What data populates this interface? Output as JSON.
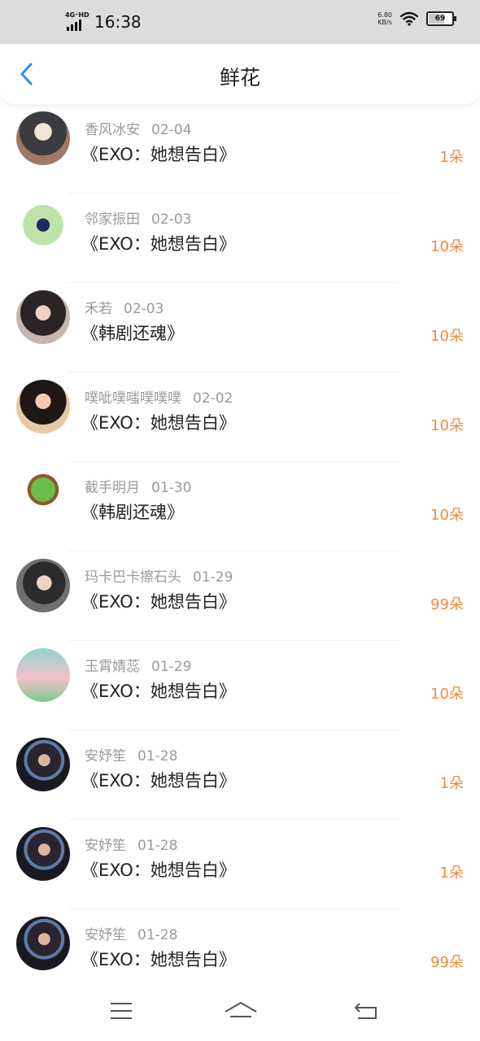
{
  "status_bar": {
    "network": "4G⁺HD",
    "time": "16:38",
    "speed_value": "6.80",
    "speed_unit": "KB/s",
    "battery": "69"
  },
  "header": {
    "title": "鲜花",
    "back_icon": "chevron-left-icon"
  },
  "colors": {
    "accent_blue": "#2a8ef0",
    "count_orange": "#f08a3c",
    "meta_gray": "#9a9a9a"
  },
  "items": [
    {
      "name": "香风冰安",
      "date": "02-04",
      "book": "《EXO：她想告白》",
      "count": "1朵"
    },
    {
      "name": "邻家振田",
      "date": "02-03",
      "book": "《EXO：她想告白》",
      "count": "10朵"
    },
    {
      "name": "禾若",
      "date": "02-03",
      "book": "《韩剧还魂》",
      "count": "10朵"
    },
    {
      "name": "噗呲噗嗤噗噗噗",
      "date": "02-02",
      "book": "《EXO：她想告白》",
      "count": "10朵"
    },
    {
      "name": "截手明月",
      "date": "01-30",
      "book": "《韩剧还魂》",
      "count": "10朵"
    },
    {
      "name": "玛卡巴卡擦石头",
      "date": "01-29",
      "book": "《EXO：她想告白》",
      "count": "99朵"
    },
    {
      "name": "玉霄婧蕊",
      "date": "01-29",
      "book": "《EXO：她想告白》",
      "count": "10朵"
    },
    {
      "name": "安妤笙",
      "date": "01-28",
      "book": "《EXO：她想告白》",
      "count": "1朵"
    },
    {
      "name": "安妤笙",
      "date": "01-28",
      "book": "《EXO：她想告白》",
      "count": "1朵"
    },
    {
      "name": "安妤笙",
      "date": "01-28",
      "book": "《EXO：她想告白》",
      "count": "99朵"
    }
  ],
  "bottom_nav": {
    "menu_icon": "menu-icon",
    "home_icon": "home-icon",
    "back_icon": "back-arrow-icon"
  }
}
